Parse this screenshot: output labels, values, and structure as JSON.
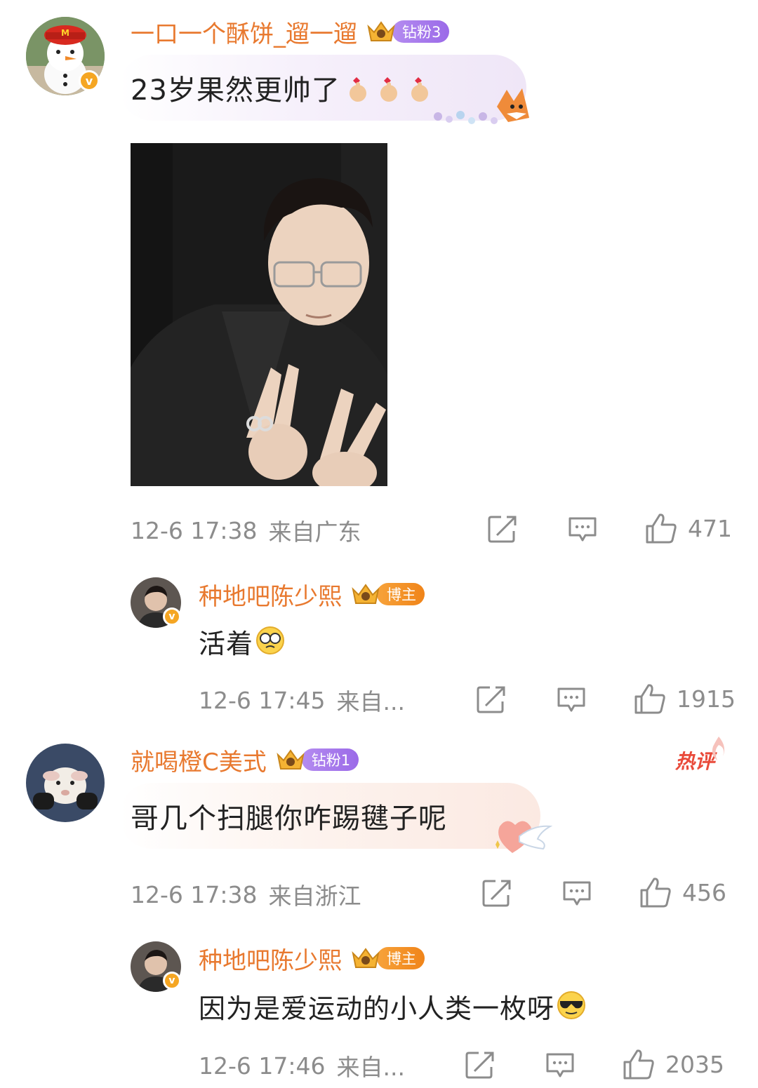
{
  "comments": [
    {
      "username": "一口一个酥饼_遛一遛",
      "fan_badge": "钻粉3",
      "text": "23岁果然更帅了",
      "time": "12-6 17:38",
      "location": "来自广东",
      "likes": "471",
      "reply": {
        "username": "种地吧陈少熙",
        "badge": "博主",
        "text": "活着",
        "time": "12-6 17:45",
        "location": "来自...",
        "likes": "1915"
      }
    },
    {
      "username": "就喝橙C美式",
      "fan_badge": "钻粉1",
      "hot_tag": "热评",
      "text": "哥几个扫腿你咋踢毽子呢",
      "time": "12-6 17:38",
      "location": "来自浙江",
      "likes": "456",
      "reply": {
        "username": "种地吧陈少熙",
        "badge": "博主",
        "text": "因为是爱运动的小人类一枚呀",
        "time": "12-6 17:46",
        "location": "来自...",
        "likes": "2035"
      }
    }
  ],
  "icons": {
    "repost": "repost-icon",
    "comment": "comment-icon",
    "like": "like-thumb-icon",
    "verified": "verified-v-icon",
    "crown": "crown-badge-icon"
  },
  "colors": {
    "username": "#e8792f",
    "meta": "#8c8c8c",
    "fan_badge_purple": "#a779ec",
    "blogger_badge_orange": "#f39328",
    "hot_tag": "#e94a3a"
  }
}
